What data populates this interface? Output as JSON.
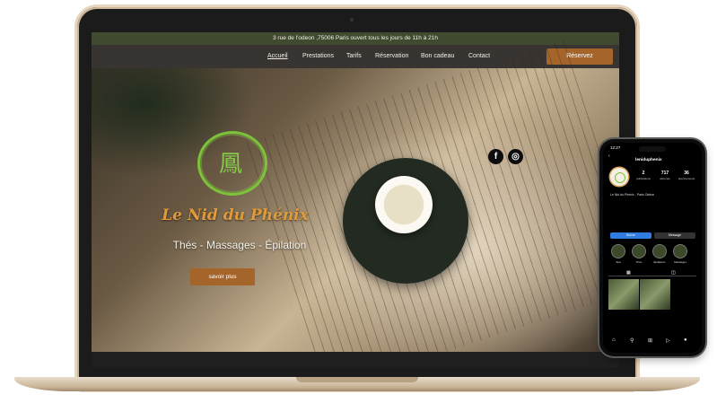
{
  "website": {
    "topbar_text": "3 rue de l'odeon ,75006 Paris ouvert tous les jours de 11h à 21h",
    "nav": [
      {
        "label": "Accueil"
      },
      {
        "label": "Prestations"
      },
      {
        "label": "Tarifs"
      },
      {
        "label": "Réservation"
      },
      {
        "label": "Bon cadeau"
      },
      {
        "label": "Contact"
      }
    ],
    "reserve_label": "Réservez",
    "logo_glyph": "鳳",
    "brand": "Le Nid du Phénix",
    "tagline": "Thés - Massages - Épilation",
    "more_label": "savoir plus",
    "social": [
      {
        "icon": "facebook-icon",
        "glyph": "f"
      },
      {
        "icon": "instagram-icon",
        "glyph": "◎"
      }
    ]
  },
  "phone": {
    "time": "12:27",
    "username": "leniduphenix",
    "stats": [
      {
        "value": "2",
        "label": "publications"
      },
      {
        "value": "717",
        "label": "abonnés"
      },
      {
        "value": "36",
        "label": "abonnements"
      }
    ],
    "bio_name": "Le Nid du Phénix - Paris Odéon",
    "follow_label": "Suivre",
    "message_label": "Message",
    "highlights": [
      {
        "label": "Spa"
      },
      {
        "label": "Thés"
      },
      {
        "label": "Épilations"
      },
      {
        "label": "Massages"
      }
    ]
  },
  "colors": {
    "accent": "#a5652a",
    "brand": "#e09a3a",
    "logo_green": "#7cc23a",
    "topbar_green": "#3f4a2e"
  }
}
